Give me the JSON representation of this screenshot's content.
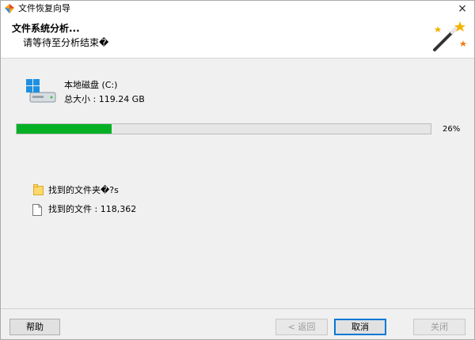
{
  "window": {
    "title": "文件恢复向导",
    "close_glyph": "×"
  },
  "header": {
    "title": "文件系统分析...",
    "subtitle": "请等待至分析结束�",
    "icon": "magic-wand-icon"
  },
  "drive": {
    "icon": "hard-drive-icon",
    "name": "本地磁盘 (C:)",
    "size": "总大小 : 119.24 GB"
  },
  "progress": {
    "value": 0.23,
    "label": "26%",
    "color": "#06b025"
  },
  "stats": {
    "folders_label": "找到的文件夹�?s",
    "files_label": "找到的文件 : 118,362"
  },
  "buttons": {
    "help": "帮助",
    "back": "< 返回",
    "cancel": "取消",
    "close": "关闭"
  },
  "colors": {
    "accent": "#0078d7",
    "progress": "#06b025"
  }
}
